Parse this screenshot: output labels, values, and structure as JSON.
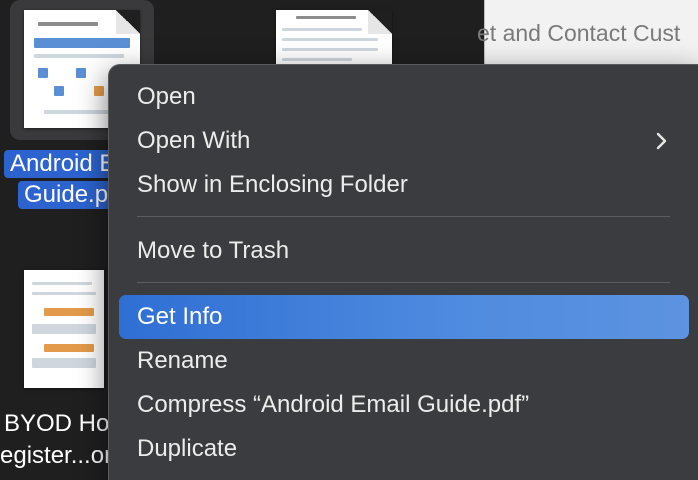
{
  "background": {
    "right_panel_text": "et and Contact Cust",
    "files": [
      {
        "label_lines": [
          "Android E",
          "Guide.p"
        ],
        "selected": true
      },
      {
        "label_lines": [
          "BYOD Ho",
          "egister...on"
        ],
        "selected": false
      }
    ]
  },
  "context_menu": {
    "items": [
      {
        "label": "Open"
      },
      {
        "label": "Open With",
        "submenu": true
      },
      {
        "label": "Show in Enclosing Folder"
      },
      {
        "label": "Move to Trash"
      },
      {
        "label": "Get Info",
        "highlighted": true
      },
      {
        "label": "Rename"
      },
      {
        "label": "Compress “Android Email Guide.pdf”"
      },
      {
        "label": "Duplicate"
      }
    ]
  },
  "colors": {
    "highlight": "#3b7bd8",
    "selection": "#2c63cf",
    "menu_bg": "#3b3c3f"
  },
  "icons": {
    "submenu_indicator": "chevron-right-icon",
    "file_icon": "pdf-document-icon"
  }
}
